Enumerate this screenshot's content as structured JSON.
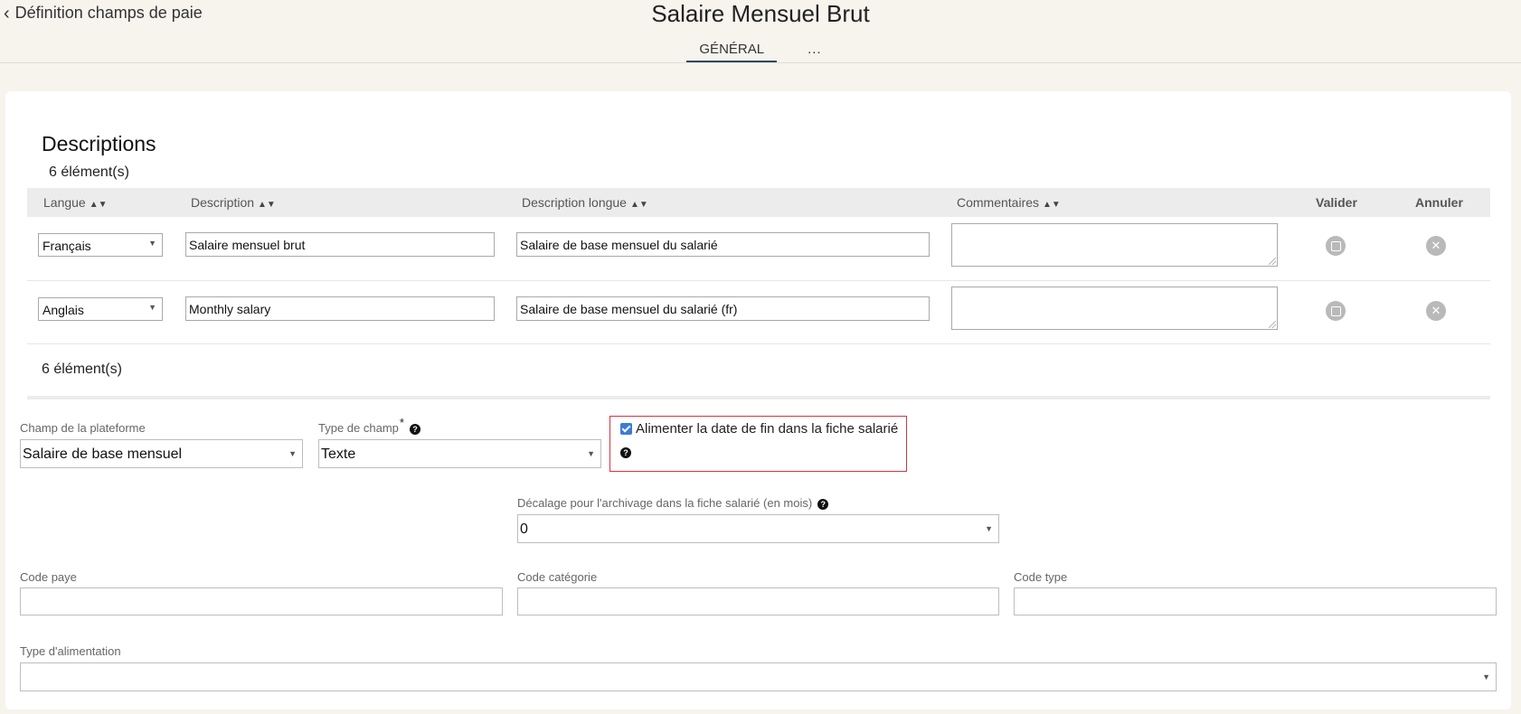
{
  "header": {
    "back_label": "Définition champs de paie",
    "title": "Salaire Mensuel Brut",
    "tabs": [
      {
        "label": "GÉNÉRAL",
        "active": true
      },
      {
        "label": "..."
      }
    ]
  },
  "descriptions": {
    "title": "Descriptions",
    "count_label": "6 élément(s)",
    "columns": {
      "langue": "Langue",
      "description": "Description",
      "description_longue": "Description longue",
      "commentaires": "Commentaires",
      "valider": "Valider",
      "annuler": "Annuler"
    },
    "rows": [
      {
        "langue": "Français",
        "description": "Salaire mensuel brut",
        "description_longue": "Salaire de base mensuel du salarié",
        "commentaires": ""
      },
      {
        "langue": "Anglais",
        "description": "Monthly salary",
        "description_longue": "Salaire de base mensuel du salarié (fr)",
        "commentaires": ""
      }
    ],
    "footer_count_label": "6 élément(s)"
  },
  "form": {
    "champ_plateforme": {
      "label": "Champ de la plateforme",
      "value": "Salaire de base mensuel"
    },
    "type_champ": {
      "label": "Type de champ",
      "required_mark": "*",
      "value": "Texte"
    },
    "alimenter": {
      "label": "Alimenter la date de fin dans la fiche salarié",
      "checked": true
    },
    "decalage": {
      "label": "Décalage pour l'archivage dans la fiche salarié (en mois)",
      "value": "0"
    },
    "code_paye": {
      "label": "Code paye",
      "value": ""
    },
    "code_categorie": {
      "label": "Code catégorie",
      "value": ""
    },
    "code_type": {
      "label": "Code type",
      "value": ""
    },
    "type_alimentation": {
      "label": "Type d'alimentation",
      "value": ""
    }
  },
  "colors": {
    "background": "#f7f4ee",
    "card": "#ffffff",
    "tab_underline": "#2b4b5f",
    "highlight_border": "#d9333f",
    "checkbox": "#3d7bd8"
  },
  "icons": {
    "back": "chevron-left-icon",
    "sort": "sort-icon",
    "validate": "validate-icon",
    "cancel": "cancel-x-icon",
    "help": "question-circle-icon",
    "dropdown": "caret-down-icon"
  }
}
